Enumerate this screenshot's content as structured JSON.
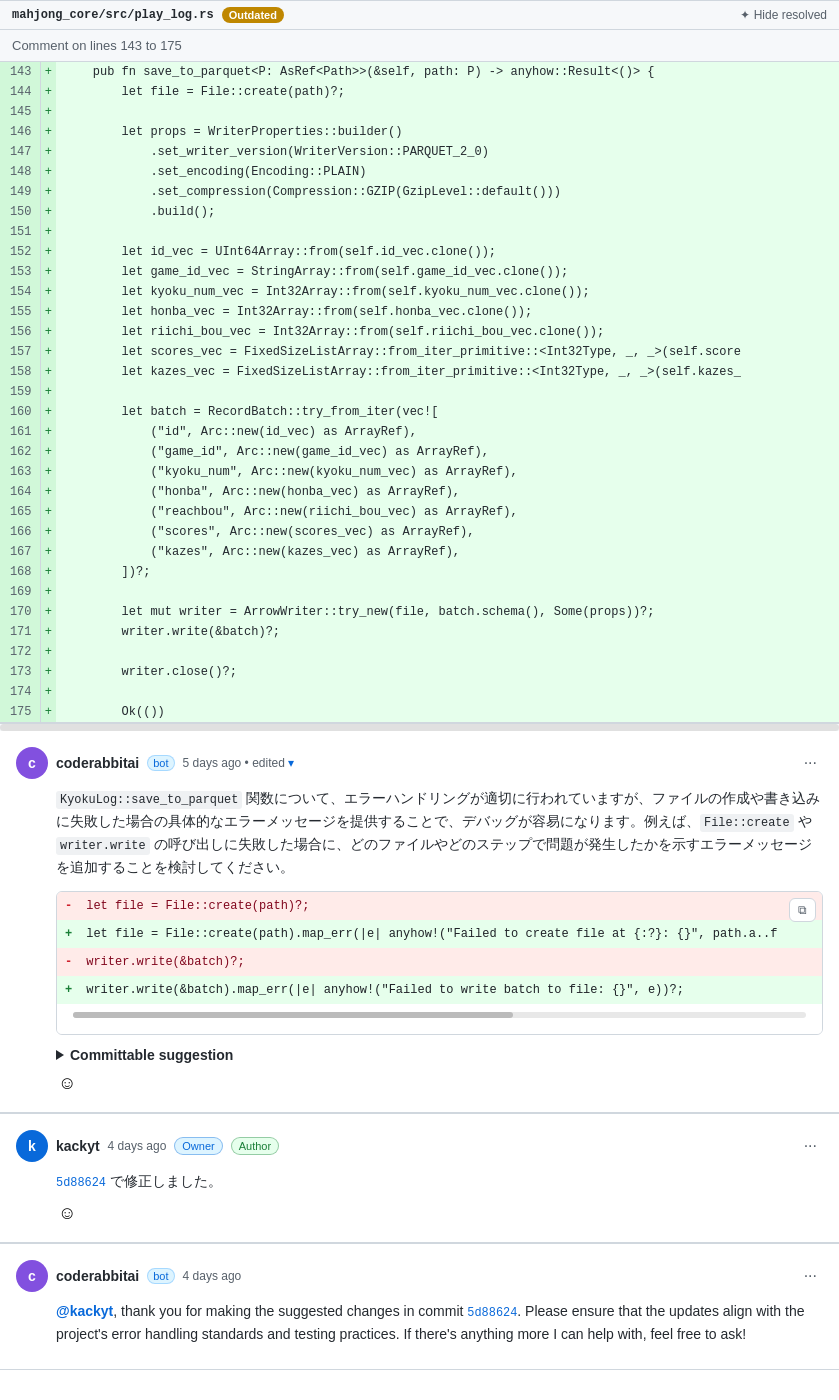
{
  "header": {
    "file_path": "mahjong_core/src/play_log.rs",
    "outdated_label": "Outdated",
    "hide_resolved_label": "Hide resolved"
  },
  "comment_on_lines": "Comment on lines 143 to 175",
  "code_lines": [
    {
      "num": 143,
      "marker": "+",
      "code": "    pub fn save_to_parquet<P: AsRef<Path>>(&self, path: P) -> anyhow::Result<()> {"
    },
    {
      "num": 144,
      "marker": "+",
      "code": "        let file = File::create(path)?;"
    },
    {
      "num": 145,
      "marker": "+",
      "code": ""
    },
    {
      "num": 146,
      "marker": "+",
      "code": "        let props = WriterProperties::builder()"
    },
    {
      "num": 147,
      "marker": "+",
      "code": "            .set_writer_version(WriterVersion::PARQUET_2_0)"
    },
    {
      "num": 148,
      "marker": "+",
      "code": "            .set_encoding(Encoding::PLAIN)"
    },
    {
      "num": 149,
      "marker": "+",
      "code": "            .set_compression(Compression::GZIP(GzipLevel::default()))"
    },
    {
      "num": 150,
      "marker": "+",
      "code": "            .build();"
    },
    {
      "num": 151,
      "marker": "+",
      "code": ""
    },
    {
      "num": 152,
      "marker": "+",
      "code": "        let id_vec = UInt64Array::from(self.id_vec.clone());"
    },
    {
      "num": 153,
      "marker": "+",
      "code": "        let game_id_vec = StringArray::from(self.game_id_vec.clone());"
    },
    {
      "num": 154,
      "marker": "+",
      "code": "        let kyoku_num_vec = Int32Array::from(self.kyoku_num_vec.clone());"
    },
    {
      "num": 155,
      "marker": "+",
      "code": "        let honba_vec = Int32Array::from(self.honba_vec.clone());"
    },
    {
      "num": 156,
      "marker": "+",
      "code": "        let riichi_bou_vec = Int32Array::from(self.riichi_bou_vec.clone());"
    },
    {
      "num": 157,
      "marker": "+",
      "code": "        let scores_vec = FixedSizeListArray::from_iter_primitive::<Int32Type, _, _>(self.score"
    },
    {
      "num": 158,
      "marker": "+",
      "code": "        let kazes_vec = FixedSizeListArray::from_iter_primitive::<Int32Type, _, _>(self.kazes_"
    },
    {
      "num": 159,
      "marker": "+",
      "code": ""
    },
    {
      "num": 160,
      "marker": "+",
      "code": "        let batch = RecordBatch::try_from_iter(vec!["
    },
    {
      "num": 161,
      "marker": "+",
      "code": "            (\"id\", Arc::new(id_vec) as ArrayRef),"
    },
    {
      "num": 162,
      "marker": "+",
      "code": "            (\"game_id\", Arc::new(game_id_vec) as ArrayRef),"
    },
    {
      "num": 163,
      "marker": "+",
      "code": "            (\"kyoku_num\", Arc::new(kyoku_num_vec) as ArrayRef),"
    },
    {
      "num": 164,
      "marker": "+",
      "code": "            (\"honba\", Arc::new(honba_vec) as ArrayRef),"
    },
    {
      "num": 165,
      "marker": "+",
      "code": "            (\"reachbou\", Arc::new(riichi_bou_vec) as ArrayRef),"
    },
    {
      "num": 166,
      "marker": "+",
      "code": "            (\"scores\", Arc::new(scores_vec) as ArrayRef),"
    },
    {
      "num": 167,
      "marker": "+",
      "code": "            (\"kazes\", Arc::new(kazes_vec) as ArrayRef),"
    },
    {
      "num": 168,
      "marker": "+",
      "code": "        ])?;"
    },
    {
      "num": 169,
      "marker": "+",
      "code": ""
    },
    {
      "num": 170,
      "marker": "+",
      "code": "        let mut writer = ArrowWriter::try_new(file, batch.schema(), Some(props))?;"
    },
    {
      "num": 171,
      "marker": "+",
      "code": "        writer.write(&batch)?;"
    },
    {
      "num": 172,
      "marker": "+",
      "code": ""
    },
    {
      "num": 173,
      "marker": "+",
      "code": "        writer.close()?;"
    },
    {
      "num": 174,
      "marker": "+",
      "code": ""
    },
    {
      "num": 175,
      "marker": "+",
      "code": "        Ok(())"
    }
  ],
  "bot_comment": {
    "username": "coderabbitai",
    "badge": "bot",
    "time": "5 days ago",
    "edited": "• edited",
    "body_parts": [
      {
        "type": "inline_code",
        "text": "KyokuLog::save_to_parquet"
      },
      {
        "type": "text",
        "text": " 関数について、エラーハンドリングが適切に行われていますが、ファイルの作成や書き込みに失敗した場合の具体的なエラーメッセージを提供することで、デバッグが容易になります。例えば、"
      },
      {
        "type": "inline_code",
        "text": "File::create"
      },
      {
        "type": "text",
        "text": " や "
      },
      {
        "type": "inline_code",
        "text": "writer.write"
      },
      {
        "type": "text",
        "text": " の呼び出しに失敗した場合に、どのファイルやどのステップで問題が発生したかを示すエラーメッセージを追加することを検討してください。"
      }
    ],
    "suggestion": {
      "removed_lines": [
        "- let file = File::create(path)?;",
        "+ let file = File::create(path).map_err(|e| anyhow!(\"Failed to create file at {:?}: {}\", path.a..f"
      ],
      "added_lines": [
        "- writer.write(&batch)?;",
        "+ writer.write(&batch).map_err(|e| anyhow!(\"Failed to write batch to file: {}\", e))?;"
      ]
    },
    "committable": "Committable suggestion"
  },
  "owner_comment": {
    "username": "kackyt",
    "time": "4 days ago",
    "owner_label": "Owner",
    "author_label": "Author",
    "commit_hash": "5d88624",
    "body": " で修正しました。"
  },
  "third_comment": {
    "username": "coderabbitai",
    "badge": "bot",
    "time": "4 days ago",
    "mention": "@kackyt",
    "body_before": ", thank you for making the suggested changes in commit ",
    "commit_hash": "5d88624",
    "body_after": ". Please ensure that the updates align with the project's error handling standards and testing practices. If there's anything more I can help with, feel free to ask!"
  },
  "icons": {
    "sparkle": "✦",
    "ellipsis": "···",
    "copy": "⧉",
    "triangle": "▶",
    "smiley": "☺"
  }
}
